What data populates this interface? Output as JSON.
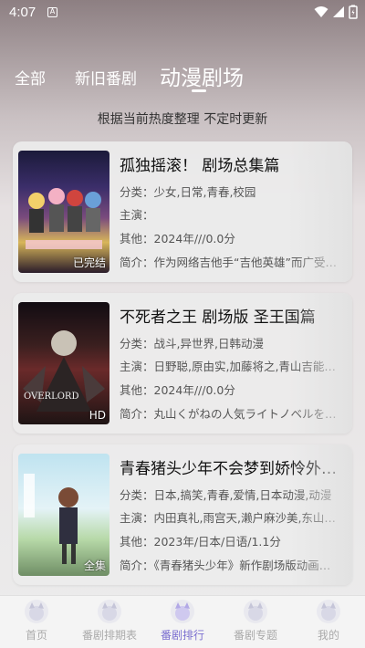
{
  "status": {
    "time": "4:07",
    "notif": "A"
  },
  "tabs": [
    {
      "label": "全部"
    },
    {
      "label": "新旧番剧"
    },
    {
      "label": "动漫剧场"
    }
  ],
  "subtitle": "根据当前热度整理 不定时更新",
  "labels": {
    "category": "分类：",
    "cast": "主演：",
    "other": "其他：",
    "intro": "简介："
  },
  "cards": [
    {
      "title": "孤独摇滚！ 剧场总集篇",
      "category": "少女,日常,青春,校园",
      "cast": "",
      "other": "2024年///0.0分",
      "intro": "作为网络吉他手“吉他英雄”而广受…",
      "badge": "已完结"
    },
    {
      "title": "不死者之王 剧场版 圣王国篇",
      "category": "战斗,异世界,日韩动漫",
      "cast": "日野聪,原由实,加藤将之,青山吉能…",
      "other": "2024年///0.0分",
      "intro": "丸山くがねの人気ライトノベルを…",
      "badge": "HD"
    },
    {
      "title": "青春猪头少年不会梦到娇怜外…",
      "category": "日本,搞笑,青春,爱情,日本动漫,动漫",
      "cast": "内田真礼,雨宫天,濑户麻沙美,东山…",
      "other": "2023年/日本/日语/1.1分",
      "intro": "《青春猪头少年》新作剧场版动画…",
      "badge": "全集"
    }
  ],
  "nav": [
    {
      "label": "首页"
    },
    {
      "label": "番剧排期表"
    },
    {
      "label": "番剧排行"
    },
    {
      "label": "番剧专题"
    },
    {
      "label": "我的"
    }
  ],
  "colors": {
    "accent": "#7b6fd0"
  }
}
